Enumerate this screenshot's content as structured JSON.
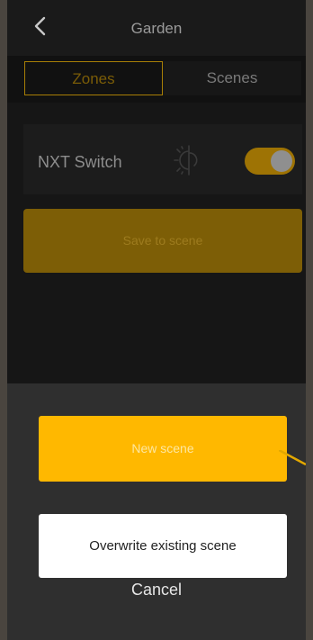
{
  "header": {
    "title": "Garden",
    "back_icon": "chevron-left-icon"
  },
  "tabs": [
    {
      "label": "Zones",
      "selected": true
    },
    {
      "label": "Scenes",
      "selected": false
    }
  ],
  "zone": {
    "name": "NXT Switch",
    "mode_icon": "sun-moon-icon",
    "toggle_on": true
  },
  "save_button": {
    "label": "Save to scene"
  },
  "action_sheet": {
    "new_scene_label": "New scene",
    "overwrite_label": "Overwrite existing scene",
    "cancel_label": "Cancel"
  },
  "colors": {
    "accent": "#ffb800",
    "accent_dimmed": "#7d5e06",
    "background": "#111111",
    "sheet": "#2f2f2f"
  }
}
